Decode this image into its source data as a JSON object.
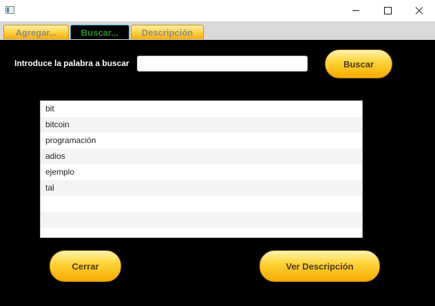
{
  "window": {
    "title": ""
  },
  "tabs": [
    {
      "label": "Agregar..."
    },
    {
      "label": "Buscar..."
    },
    {
      "label": "Descripción"
    }
  ],
  "search": {
    "label": "Introduce la palabra a buscar",
    "value": "",
    "placeholder": "",
    "button_label": "Buscar"
  },
  "word_list": {
    "items": [
      "bit",
      "bitcoin",
      "programación",
      "adios",
      "ejemplo",
      "tal",
      "",
      "",
      ""
    ]
  },
  "footer": {
    "close_label": "Cerrar",
    "view_description_label": "Ver Descripción"
  },
  "colors": {
    "background": "#000000",
    "button_gold": "#ffd43a",
    "active_tab_text": "#2c8f2c",
    "active_tab_border": "#2aa7c6"
  }
}
